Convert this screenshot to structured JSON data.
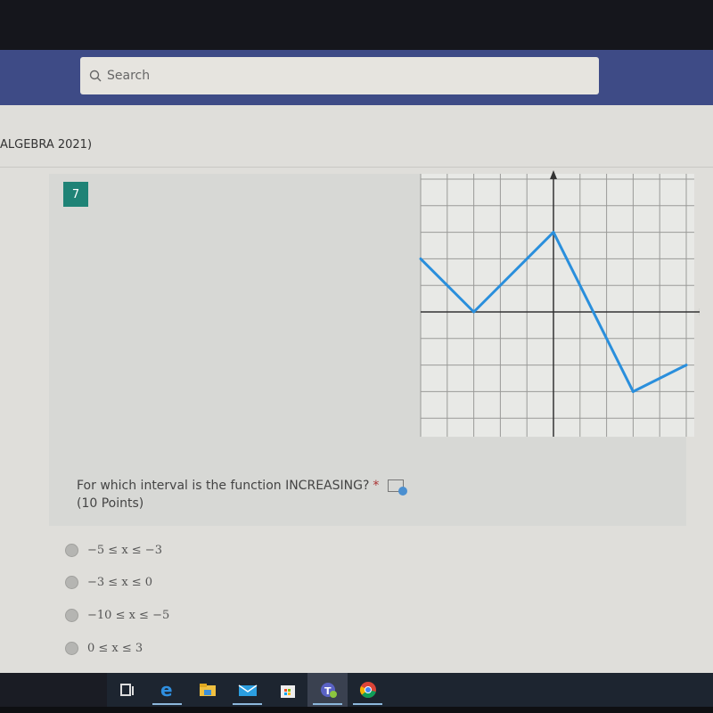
{
  "search": {
    "placeholder": "Search"
  },
  "form": {
    "title": "ALGEBRA 2021)"
  },
  "question": {
    "number": "7",
    "text": "For which interval is the function INCREASING?",
    "required_mark": "*",
    "points": "(10 Points)",
    "options": [
      {
        "label": "−5 ≤ x ≤ −3",
        "selected": false
      },
      {
        "label": "−3 ≤ x ≤ 0",
        "selected": false
      },
      {
        "label": "−10 ≤ x ≤ −5",
        "selected": false
      },
      {
        "label": "0 ≤ x ≤ 3",
        "selected": false
      }
    ]
  },
  "chart_data": {
    "type": "line",
    "x": [
      -5,
      -3,
      0,
      3,
      5
    ],
    "y": [
      2,
      0,
      3,
      -3,
      -2
    ],
    "xlim": [
      -5,
      5.3
    ],
    "ylim": [
      -4.7,
      5.2
    ],
    "grid": true,
    "line_color": "#2a8fdc"
  },
  "taskbar": {
    "icons": [
      "task-view-icon",
      "edge-icon",
      "file-explorer-icon",
      "mail-icon",
      "store-icon",
      "teams-icon",
      "chrome-icon"
    ]
  }
}
